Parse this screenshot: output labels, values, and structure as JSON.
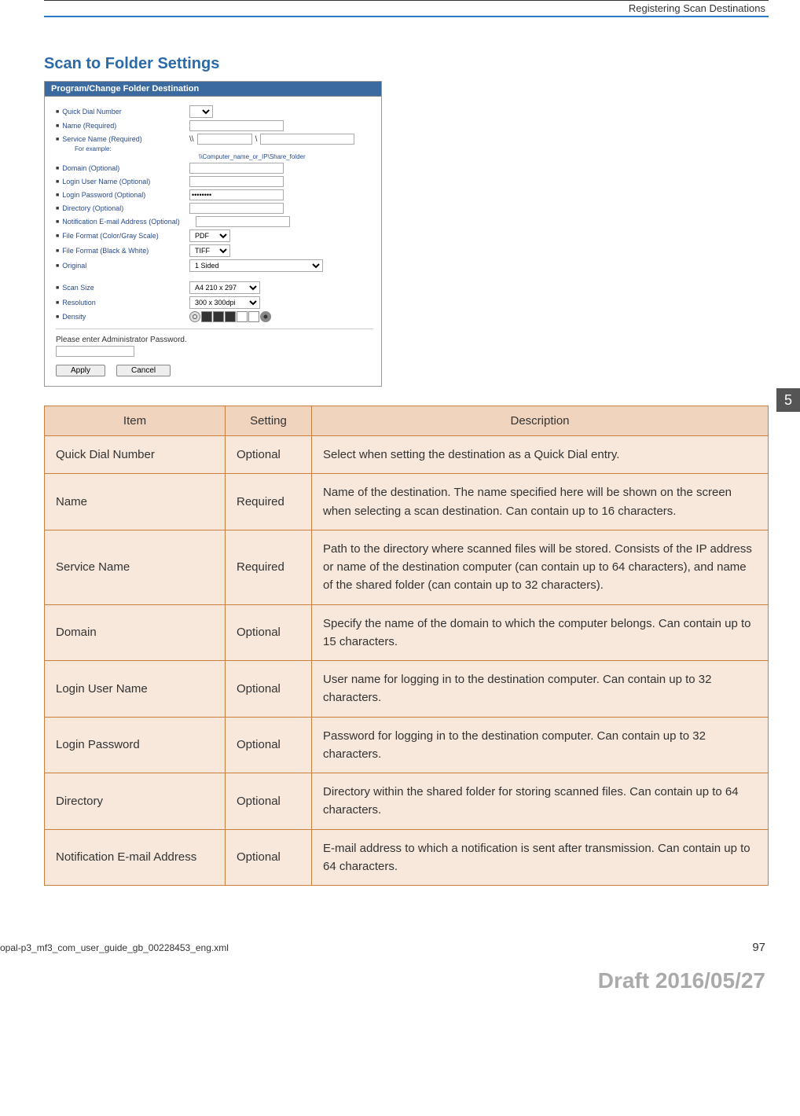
{
  "header": {
    "section_title": "Registering Scan Destinations"
  },
  "chapter": {
    "number": "5"
  },
  "heading": "Scan to Folder Settings",
  "panel": {
    "title": "Program/Change Folder Destination",
    "rows": {
      "quick_dial": {
        "label": "Quick Dial Number",
        "value": ""
      },
      "name": {
        "label": "Name (Required)",
        "value": ""
      },
      "service": {
        "label": "Service Name (Required)",
        "prefix": "\\\\",
        "sep": "\\",
        "v1": "",
        "v2": ""
      },
      "example": {
        "label": "For example:",
        "text": "\\\\Computer_name_or_IP\\Share_folder"
      },
      "domain": {
        "label": "Domain (Optional)",
        "value": ""
      },
      "login_user": {
        "label": "Login User Name (Optional)",
        "value": ""
      },
      "login_pw": {
        "label": "Login Password (Optional)",
        "value": "••••••••"
      },
      "directory": {
        "label": "Directory (Optional)",
        "value": ""
      },
      "notif": {
        "label": "Notification E-mail Address (Optional)",
        "value": ""
      },
      "ff_color": {
        "label": "File Format (Color/Gray Scale)",
        "value": "PDF"
      },
      "ff_bw": {
        "label": "File Format (Black & White)",
        "value": "TIFF"
      },
      "original": {
        "label": "Original",
        "value": "1 Sided"
      },
      "scan_size": {
        "label": "Scan Size",
        "value": "A4 210 x 297"
      },
      "resolution": {
        "label": "Resolution",
        "value": "300 x 300dpi"
      },
      "density": {
        "label": "Density"
      }
    },
    "admin_pw_label": "Please enter Administrator Password.",
    "buttons": {
      "apply": "Apply",
      "cancel": "Cancel"
    }
  },
  "table": {
    "headers": {
      "item": "Item",
      "setting": "Setting",
      "description": "Description"
    },
    "rows": [
      {
        "item": "Quick Dial Number",
        "setting": "Optional",
        "desc": "Select when setting the destination as a Quick Dial entry."
      },
      {
        "item": "Name",
        "setting": "Required",
        "desc": "Name of the destination. The name specified here will be shown on the screen when selecting a scan destination. Can contain up to 16 characters."
      },
      {
        "item": "Service Name",
        "setting": "Required",
        "desc": "Path to the directory where scanned files will be stored. Consists of the IP address or name of the destination computer (can contain up to 64 characters), and name of the shared folder (can contain up to 32 characters)."
      },
      {
        "item": "Domain",
        "setting": "Optional",
        "desc": "Specify the name of the domain to which the computer belongs. Can contain up to 15 characters."
      },
      {
        "item": "Login User Name",
        "setting": "Optional",
        "desc": "User name for logging in to the destination computer. Can contain up to 32 characters."
      },
      {
        "item": "Login Password",
        "setting": "Optional",
        "desc": "Password for logging in to the destination computer. Can contain up to 32 characters."
      },
      {
        "item": "Directory",
        "setting": "Optional",
        "desc": "Directory within the shared folder for storing scanned files. Can contain up to 64 characters."
      },
      {
        "item": "Notification E-mail Address",
        "setting": "Optional",
        "desc": "E-mail address to which a notification is sent after transmission. Can contain up to 64 characters."
      }
    ]
  },
  "footer": {
    "file": "opal-p3_mf3_com_user_guide_gb_00228453_eng.xml",
    "page": "97"
  },
  "draft": "Draft 2016/05/27"
}
